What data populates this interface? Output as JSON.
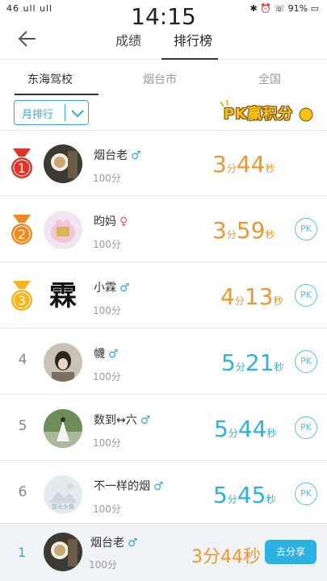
{
  "status_bar": {
    "signal": "46 ull ull",
    "time": "14:15",
    "right": "✱ ⏰ ☏ 91% ▭"
  },
  "header": {
    "tabs": [
      {
        "label": "成绩"
      },
      {
        "label": "排行榜"
      }
    ],
    "active_tab": "排行榜"
  },
  "sub_tabs": [
    {
      "label": "东海驾校"
    },
    {
      "label": "烟台市"
    },
    {
      "label": "全国"
    }
  ],
  "filter": {
    "selected": "月排行"
  },
  "pk_banner": {
    "text": "PK赢积分"
  },
  "list": [
    {
      "rank": "1",
      "name": "烟台老",
      "gender": "♂",
      "score": "100分",
      "min": "3",
      "min_unit": "分",
      "sec": "44",
      "sec_unit": "秒",
      "pk": ""
    },
    {
      "rank": "2",
      "name": "昀妈",
      "gender": "♀",
      "score": "100分",
      "min": "3",
      "min_unit": "分",
      "sec": "59",
      "sec_unit": "秒",
      "pk": "PK"
    },
    {
      "rank": "3",
      "name": "小霖",
      "gender": "♂",
      "score": "100分",
      "min": "4",
      "min_unit": "分",
      "sec": "13",
      "sec_unit": "秒",
      "pk": "PK"
    },
    {
      "rank": "4",
      "name": "幭",
      "gender": "♂",
      "score": "100分",
      "min": "5",
      "min_unit": "分",
      "sec": "21",
      "sec_unit": "秒",
      "pk": "PK"
    },
    {
      "rank": "5",
      "name": "数到↔六",
      "gender": "♂",
      "score": "100分",
      "min": "5",
      "min_unit": "分",
      "sec": "44",
      "sec_unit": "秒",
      "pk": "PK"
    },
    {
      "rank": "6",
      "name": "不一样的烟",
      "gender": "♂",
      "score": "100分",
      "min": "5",
      "min_unit": "分",
      "sec": "45",
      "sec_unit": "秒",
      "pk": "PK"
    }
  ],
  "avatar_texts": {
    "row3": "霖",
    "row6": "暂无头像"
  },
  "my_rank": {
    "rank": "1",
    "name": "烟台老",
    "gender": "♂",
    "score": "100分",
    "time": "3分44秒",
    "share_label": "去分享"
  },
  "colors": {
    "orange": "#f0962a",
    "blue": "#2fb0e2",
    "accent": "#3aa7d9",
    "medal_red": "#e0342a",
    "medal_orange": "#f08a1e",
    "medal_gold": "#f3b61c"
  }
}
